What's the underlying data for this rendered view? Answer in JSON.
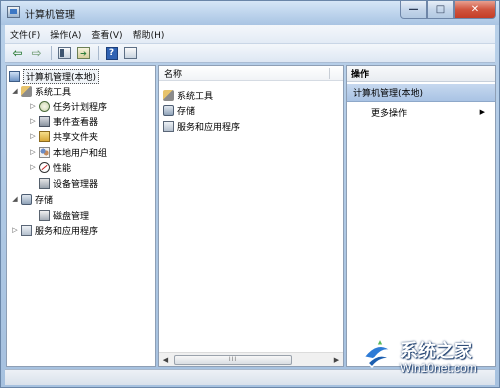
{
  "window": {
    "title": "计算机管理",
    "minimize_glyph": "—",
    "maximize_glyph": "□",
    "close_glyph": "✕"
  },
  "menu": {
    "items": [
      "文件(F)",
      "操作(A)",
      "查看(V)",
      "帮助(H)"
    ]
  },
  "toolbar": {
    "back_glyph": "⇦",
    "forward_glyph": "⇨",
    "help_glyph": "?",
    "export_glyph": "➔",
    "icons": [
      "back-arrow-icon",
      "forward-arrow-icon",
      "console-tree-icon",
      "export-list-icon",
      "help-icon",
      "show-hide-pane-icon"
    ]
  },
  "tree": {
    "root": "计算机管理(本地)",
    "system_tools": "系统工具",
    "task_scheduler": "任务计划程序",
    "event_viewer": "事件查看器",
    "shared_folders": "共享文件夹",
    "local_users": "本地用户和组",
    "performance": "性能",
    "device_manager": "设备管理器",
    "storage": "存储",
    "disk_management": "磁盘管理",
    "services_apps": "服务和应用程序",
    "expanded_glyph": "◢",
    "collapsed_glyph": "▷"
  },
  "center": {
    "column_header": "名称",
    "rows": [
      "系统工具",
      "存储",
      "服务和应用程序"
    ],
    "scroll_left": "◀",
    "scroll_right": "▶",
    "thumb_grip": "III"
  },
  "actions": {
    "header": "操作",
    "section": "计算机管理(本地)",
    "more_actions": "更多操作",
    "more_arrow": "▶"
  },
  "watermark": {
    "title": "系统之家",
    "url": "Win10net.com"
  }
}
